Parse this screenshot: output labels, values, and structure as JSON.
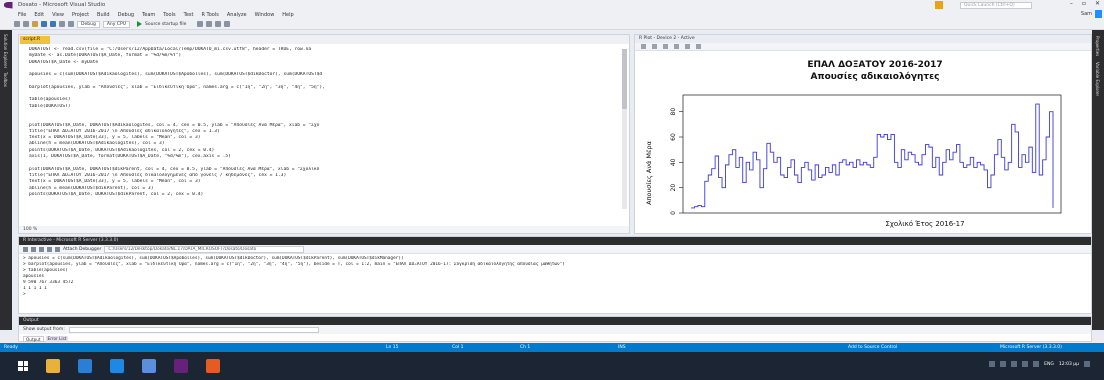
{
  "window": {
    "title": "Dosato - Microsoft Visual Studio",
    "quick_launch_placeholder": "Quick Launch (Ctrl+Q)",
    "user": "Sam"
  },
  "menu": [
    "File",
    "Edit",
    "View",
    "Project",
    "Build",
    "Debug",
    "Team",
    "Tools",
    "Test",
    "R Tools",
    "Analyze",
    "Window",
    "Help"
  ],
  "toolbar": {
    "config": "Debug",
    "platform": "Any CPU",
    "startup": "Source startup file"
  },
  "side_tabs": {
    "left": [
      "Solution Explorer",
      "Toolbox"
    ],
    "right": [
      "Properties",
      "Variable Explorer"
    ]
  },
  "editor": {
    "tab_label": "script.R",
    "zoom": "100 %",
    "lines": [
      "DOKATOST <- read.csv(file = \"C:/Users/12/AppData/Local/Temp/DOKATO_mi.csv.utf8\", header = TRUE, row.na",
      "myDate <- as.Date(DOKATOST$A_Date, format = \"%d/%m/%Y\")",
      "DOKATOST$A_Date <- myDate",
      "",
      "apousies = c(sum(DOKATOST$Adikaologites), sum(DOKATOST$Apobolles), sum(DOKATOST$dikDoctor), sum(DOKATOST$d",
      "",
      "barplot(apousies, ylab = \"Απουσίες\", xlab = \"Ειδικευτική Όρα\", names.arg = c(\"1η\", \"2η\", \"3η\", \"4η\", \"5η\"),",
      "",
      "table(apousies)",
      "table(DOKATOST)",
      "",
      "",
      "plot(DOKATOST$A_Date, DOKATOST$Adikaologites, col = 4, cex = 0.5, ylab = \"Απουσίες Ανά Μέρα\", xlab = \"Σχο",
      "title(\"ΕΠΑΛ ΔΟΞΑΤΟΥ 2016-2017 \\n Απουσίες αδικαιολόγητες\", cex = 1.3)",
      "text(x = DOKATOST$A_Date[33], y = 5, labels = \"Mean\", col = 3)",
      "abline(h = mean(DOKATOST$Adikaologites), col = 3)",
      "points(DOKATOST$A_Date, DOKATOST$Adikaologites, col = 2, cex = 0.4)",
      "axis(1, DOKATOST$A_Date, format(DOKATOST$A_Date, \"%d/%m\"), cex.axis = .5)",
      "",
      "plot(DOKATOST$A_Date, DOKATOST$dikParent, col = 4, cex = 0.5, ylab = \"Απουσίες Ανά Μέρα\", xlab = \"Σχολικό",
      "title(\"ΕΠΑΛ ΔΟΞΑΤΟΥ 2016-2017 \\n Απουσίες δικαιολογημένες από γονείς / κηδεμόνες\", cex = 1.3)",
      "text(x = DOKATOST$A_Date[33], y = 5, labels = \"Mean\", col = 3)",
      "abline(h = mean(DOKATOST$dikParent), col = 3)",
      "points(DOKATOST$A_Date, DOKATOST$dikParent, col = 2, cex = 0.4)"
    ]
  },
  "plot_pane": {
    "window_title": "R Plot - Device 2 - Active"
  },
  "chart_data": {
    "type": "line",
    "title": "ΕΠΑΛ ΔΟΞΑΤΟΥ 2016-2017",
    "subtitle": "Απουσίες αδικαιολόγητες",
    "xlabel": "Σχολικό Έτος 2016-17",
    "ylabel": "Απουσίες Ανά Μέρα",
    "ylim": [
      0,
      90
    ],
    "yticks": [
      0,
      20,
      40,
      60,
      80
    ],
    "grid": false,
    "series": [
      {
        "values": [
          4,
          5,
          6,
          5,
          25,
          30,
          35,
          45,
          28,
          20,
          38,
          46,
          50,
          36,
          44,
          24,
          40,
          34,
          48,
          42,
          20,
          35,
          55,
          48,
          40,
          44,
          30,
          28,
          36,
          42,
          30,
          24,
          36,
          40,
          34,
          26,
          38,
          28,
          30,
          36,
          32,
          38,
          30,
          40,
          42,
          38,
          40,
          36,
          42,
          38,
          40,
          38,
          36,
          44,
          62,
          60,
          62,
          58,
          62,
          40,
          36,
          50,
          42,
          48,
          46,
          40,
          38,
          46,
          54,
          52,
          36,
          44,
          30,
          40,
          50,
          42,
          48,
          54,
          40,
          36,
          38,
          44,
          36,
          40,
          38,
          34,
          20,
          30,
          46,
          58,
          44,
          34,
          40,
          70,
          64,
          36,
          46,
          40,
          52,
          32,
          86,
          30,
          42,
          60,
          80,
          4
        ]
      }
    ]
  },
  "interactive": {
    "title": "R Interactive - Microsoft R Server (3.3.3.0)",
    "attach_label": "Attach Debugger",
    "path": "C:/Users/12/Desktop/Dokato/NL.17/DATA_MICROSOFT/Dosato/Dosato",
    "zoom": "100 %",
    "lines": [
      "> apousies = c(sum(DOKATOST$Adikaologites), sum(DOKATOST$Apobolles), sum(DOKATOST$dikDoctor), sum(DOKATOST$dikParent), sum(DOKATOST$dikManager))",
      "> barplot(apousies, ylab = \"Απουσίες\", xlab = \"Ειδικευτική Όρα\", names.arg = c(\"1η\", \"2η\", \"3η\", \"4η\", \"5η\"), beside = T, col = 1:2, main = \"ΕΠΑΛ ΔΟΞΑΤΟΥ 2016-17: Σύγκριση αδικαιολόγητης απουσίας μαθητών\")",
      "> table(apousies)",
      "apousies",
      "   9   590   767  3363  4572",
      "   1     1     1     1     1",
      ">"
    ]
  },
  "output": {
    "title": "Output",
    "show_from_label": "Show output from:",
    "tabs": [
      "Output",
      "Error List"
    ]
  },
  "status": {
    "left": "Ready",
    "line": "Ln 15",
    "col": "Col 1",
    "ch": "Ch 1",
    "mode": "INS",
    "source_control": "Add to Source Control",
    "server": "Microsoft R Server (3.3.3.0)"
  },
  "taskbar": {
    "time": "12:03 μμ",
    "lang": "ENG"
  },
  "colors": {
    "accent": "#007acc",
    "plot_line": "#3a3ad8",
    "editor_tab": "#f0c23c"
  }
}
